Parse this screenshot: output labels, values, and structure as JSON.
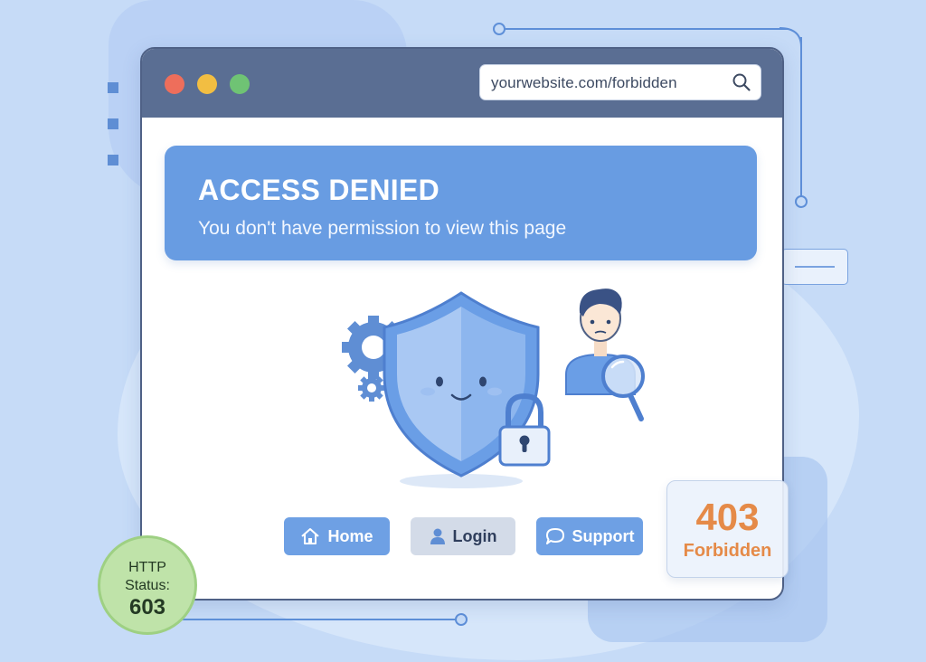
{
  "browser": {
    "url": "yourwebsite.com/forbidden"
  },
  "banner": {
    "title": "ACCESS DENIED",
    "subtitle": "You don't have permission to view this page"
  },
  "buttons": {
    "home": "Home",
    "login": "Login",
    "support": "Support"
  },
  "error_card": {
    "code": "403",
    "label": "Forbidden"
  },
  "status_badge": {
    "line1": "HTTP",
    "line2": "Status:",
    "value": "603"
  },
  "icons": {
    "window_controls": [
      "close-dot-icon",
      "minimize-dot-icon",
      "maximize-dot-icon"
    ],
    "url_bar": "search-icon",
    "illustration": [
      "shield-icon",
      "gear-icon",
      "padlock-icon",
      "user-avatar-icon",
      "magnifier-icon"
    ],
    "home_button": "home-icon",
    "login_button": "user-icon",
    "support_button": "chat-bubble-icon"
  },
  "colors": {
    "background": "#c6dbf7",
    "titlebar": "#5a6e93",
    "banner": "#689ce2",
    "primary_button": "#6ea0e4",
    "secondary_button": "#d3dbe8",
    "error_code": "#e58a48",
    "status_badge": "#bfe3a9"
  }
}
